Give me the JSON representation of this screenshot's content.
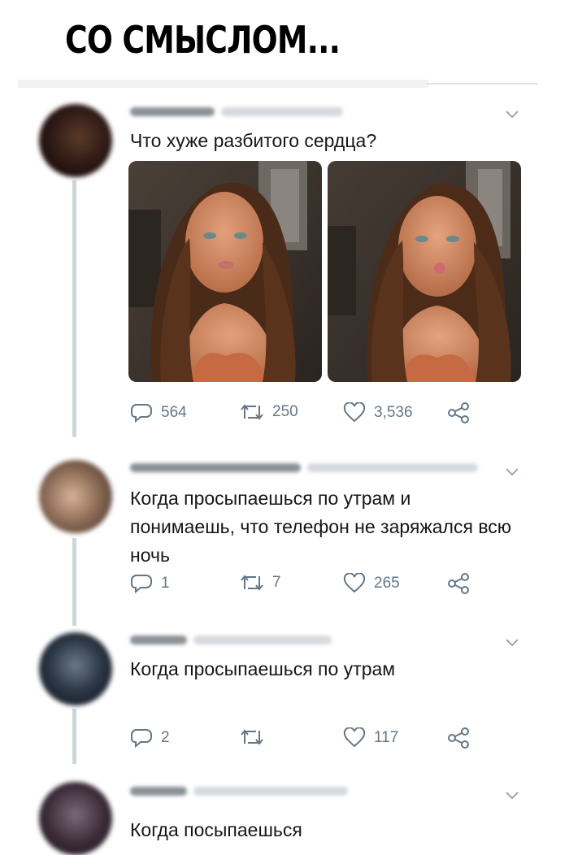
{
  "header": {
    "title": "СО СМЫСЛОМ..."
  },
  "colors": {
    "icon_gray": "#657786",
    "thread": "#ccd6dd",
    "text": "#14171a"
  },
  "tweets": [
    {
      "text": "Что хуже разбитого сердца?",
      "images": [
        "selfie-photo",
        "selfie-pout-photo"
      ],
      "replies": "564",
      "retweets": "250",
      "likes": "3,536"
    },
    {
      "text": "Когда просыпаешься по утрам и понимаешь, что телефон не заряжался всю ночь",
      "replies": "1",
      "retweets": "7",
      "likes": "265"
    },
    {
      "text": "Когда просыпаешься по утрам",
      "replies": "2",
      "retweets": "",
      "likes": "117"
    },
    {
      "text": "Когда посыпаешься"
    }
  ],
  "icons": [
    "reply-icon",
    "retweet-icon",
    "like-icon",
    "share-icon",
    "chevron-down-icon"
  ]
}
